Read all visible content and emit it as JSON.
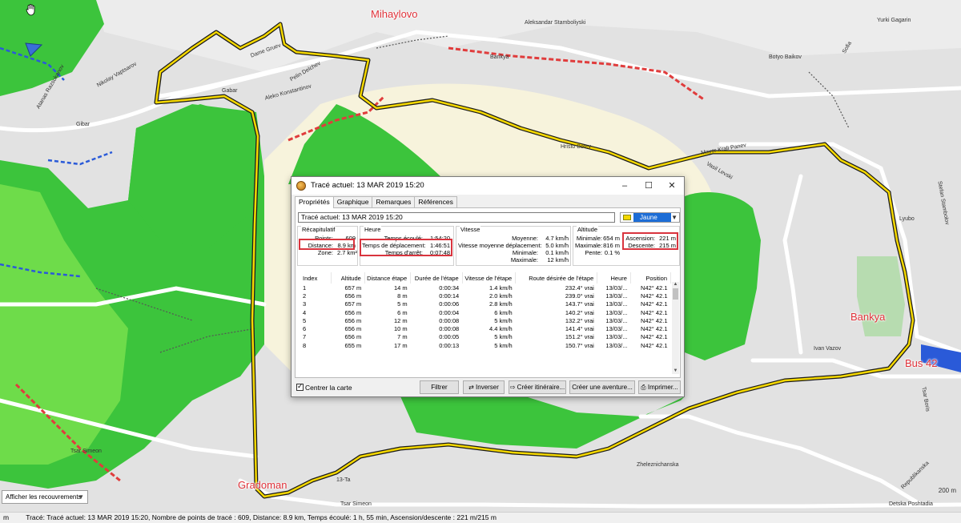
{
  "map": {
    "places": [
      "Mihaylovo",
      "Bankya",
      "Gradoman",
      "Bus 42"
    ],
    "streets": [
      "Atanas Razsukanov",
      "Nikolay Vaptsarov",
      "Dame Gruev",
      "Pelin Delchev",
      "Aleko Konstantinov",
      "Gabar",
      "Gibar",
      "Hristo Botev",
      "Vasil Levski",
      "Mayor Krali Panev",
      "Ivan Vazov",
      "Zheleznichanska",
      "Tsar Simeon",
      "Detska Poshtadia",
      "Republikanska",
      "Bankya",
      "Tsar Simeon",
      "13-Ta",
      "Stefan Stambolov",
      "Yurki Gagarin",
      "Sofia",
      "Botyo Baikov",
      "Aleksandar Stamboliyski",
      "Lyubo",
      "Tsar Boris"
    ],
    "scale_label": "200 m",
    "overlay_select": "Afficher les recouvrements",
    "colors": {
      "forest": "#3cc43c",
      "light": "#f7f3dc",
      "base": "#e2e2e2",
      "track": "#f5d800",
      "road_red": "#e03c3c",
      "road_blue": "#2a5ad8",
      "place": "#e0323a"
    }
  },
  "status": {
    "unit": "m",
    "text": "Tracé: Tracé actuel: 13 MAR 2019 15:20, Nombre de points de tracé : 609, Distance: 8.9 km, Temps écoulé: 1 h, 55 min, Ascension/descente : 221 m/215 m"
  },
  "dialog": {
    "title": "Tracé actuel: 13 MAR 2019 15:20",
    "tabs": [
      "Propriétés",
      "Graphique",
      "Remarques",
      "Références"
    ],
    "track_name": "Tracé actuel: 13 MAR 2019 15:20",
    "color_name": "Jaune",
    "summary": {
      "heading": "Récapitulatif",
      "points_label": "Points:",
      "points_value": "609",
      "distance_label": "Distance:",
      "distance_value": "8.9 km",
      "zone_label": "Zone:",
      "zone_value": "2.7 km²"
    },
    "time": {
      "heading": "Heure",
      "elapsed_label": "Temps écoulé:",
      "elapsed_value": "1:54:20",
      "moving_label": "Temps de déplacement:",
      "moving_value": "1:46:51",
      "stopped_label": "Temps d'arrêt:",
      "stopped_value": "0:07:48"
    },
    "speed": {
      "heading": "Vitesse",
      "avg_label": "Moyenne:",
      "avg_value": "4.7 km/h",
      "moving_avg_label": "Vitesse moyenne déplacement:",
      "moving_avg_value": "5.0 km/h",
      "min_label": "Minimale:",
      "min_value": "0.1 km/h",
      "max_label": "Maximale:",
      "max_value": "12 km/h"
    },
    "altitude": {
      "heading": "Altitude",
      "min_label": "Minimale:",
      "min_value": "654 m",
      "max_label": "Maximale:",
      "max_value": "816 m",
      "slope_label": "Pente:",
      "slope_value": "0.1 %",
      "ascent_label": "Ascension:",
      "ascent_value": "221 m",
      "descent_label": "Descente:",
      "descent_value": "215 m"
    },
    "table": {
      "headers": [
        "Index",
        "Altitude",
        "Distance étape",
        "Durée de l'étape",
        "Vitesse de l'étape",
        "Route désirée de l'étape",
        "Heure",
        "Position"
      ],
      "rows": [
        [
          "1",
          "657 m",
          "14 m",
          "0:00:34",
          "1.4 km/h",
          "232.4° vrai",
          "13/03/...",
          "N42° 42.1"
        ],
        [
          "2",
          "656 m",
          "8 m",
          "0:00:14",
          "2.0 km/h",
          "239.0° vrai",
          "13/03/...",
          "N42° 42.1"
        ],
        [
          "3",
          "657 m",
          "5 m",
          "0:00:06",
          "2.8 km/h",
          "143.7° vrai",
          "13/03/...",
          "N42° 42.1"
        ],
        [
          "4",
          "656 m",
          "6 m",
          "0:00:04",
          "6 km/h",
          "140.2° vrai",
          "13/03/...",
          "N42° 42.1"
        ],
        [
          "5",
          "656 m",
          "12 m",
          "0:00:08",
          "5 km/h",
          "132.2° vrai",
          "13/03/...",
          "N42° 42.1"
        ],
        [
          "6",
          "656 m",
          "10 m",
          "0:00:08",
          "4.4 km/h",
          "141.4° vrai",
          "13/03/...",
          "N42° 42.1"
        ],
        [
          "7",
          "656 m",
          "7 m",
          "0:00:05",
          "5 km/h",
          "151.2° vrai",
          "13/03/...",
          "N42° 42.1"
        ],
        [
          "8",
          "655 m",
          "17 m",
          "0:00:13",
          "5 km/h",
          "150.7° vrai",
          "13/03/...",
          "N42° 42.1"
        ]
      ]
    },
    "center_map_label": "Centrer la carte",
    "buttons": {
      "filter": "Filtrer",
      "invert": "Inverser",
      "create_route": "Créer itinéraire...",
      "create_adventure": "Créer une aventure...",
      "print": "Imprimer..."
    }
  }
}
